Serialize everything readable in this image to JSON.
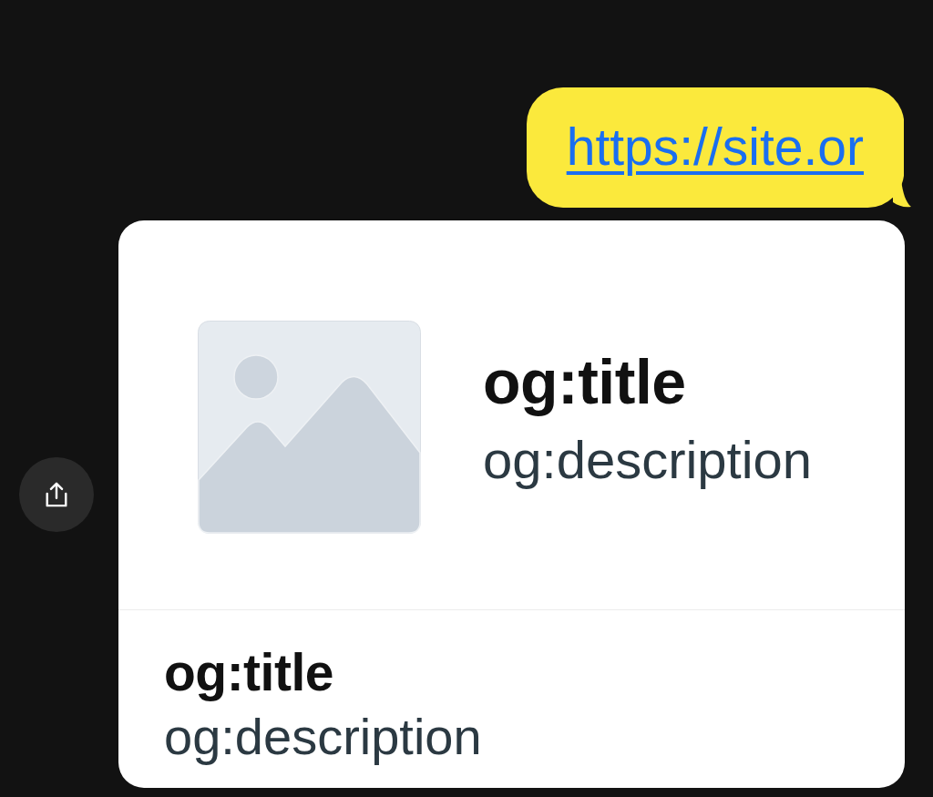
{
  "message": {
    "link": "https://site.or"
  },
  "link_preview": {
    "header": {
      "title": "og:title",
      "description": "og:description"
    },
    "footer": {
      "title": "og:title",
      "description": "og:description"
    }
  }
}
